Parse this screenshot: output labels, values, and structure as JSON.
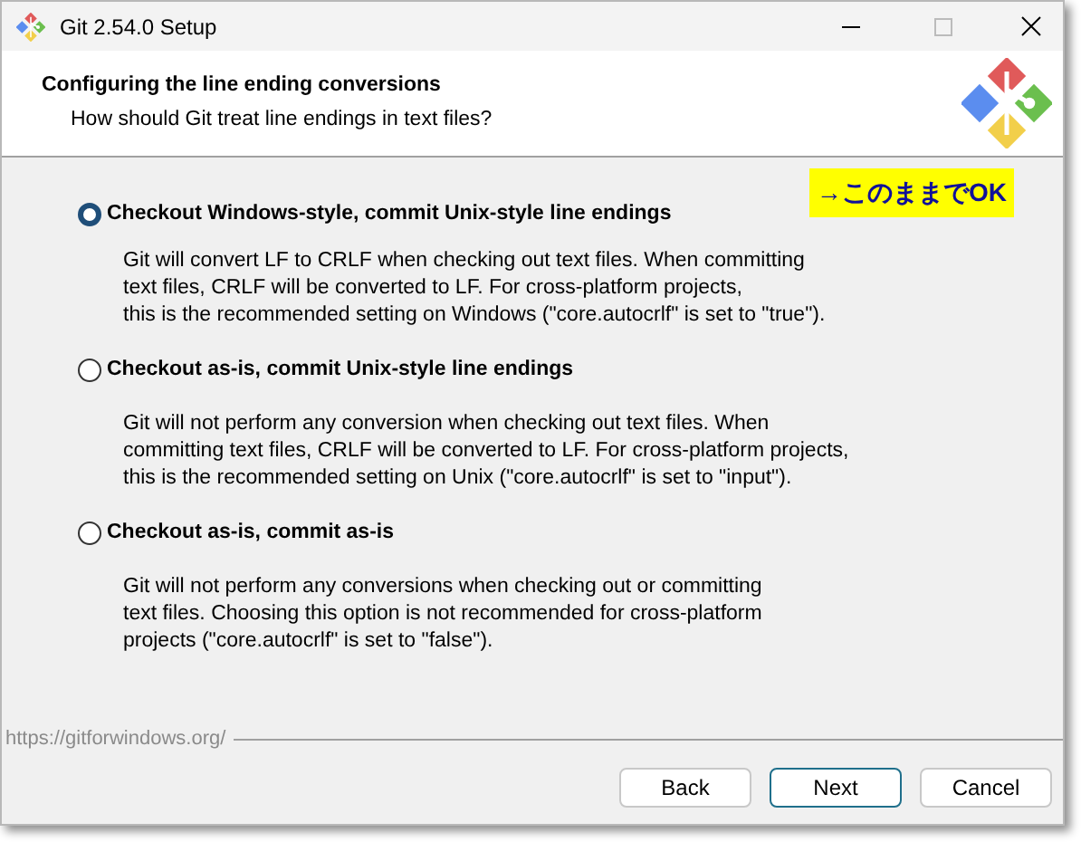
{
  "window": {
    "title": "Git 2.54.0 Setup"
  },
  "header": {
    "title": "Configuring the line ending conversions",
    "subtitle": "How should Git treat line endings in text files?"
  },
  "annotation": "→このままでOK",
  "options": [
    {
      "label": "Checkout Windows-style, commit Unix-style line endings",
      "selected": true,
      "description": [
        "Git will convert LF to CRLF when checking out text files. When committing",
        "text files, CRLF will be converted to LF. For cross-platform projects,",
        "this is the recommended setting on Windows (\"core.autocrlf\" is set to \"true\")."
      ]
    },
    {
      "label": "Checkout as-is, commit Unix-style line endings",
      "selected": false,
      "description": [
        "Git will not perform any conversion when checking out text files. When",
        "committing text files, CRLF will be converted to LF. For cross-platform projects,",
        "this is the recommended setting on Unix (\"core.autocrlf\" is set to \"input\")."
      ]
    },
    {
      "label": "Checkout as-is, commit as-is",
      "selected": false,
      "description": [
        "Git will not perform any conversions when checking out or committing",
        "text files. Choosing this option is not recommended for cross-platform",
        "projects (\"core.autocrlf\" is set to \"false\")."
      ]
    }
  ],
  "footer": {
    "url": "https://gitforwindows.org/"
  },
  "buttons": [
    {
      "label": "Back",
      "default": false
    },
    {
      "label": "Next",
      "default": true
    },
    {
      "label": "Cancel",
      "default": false
    }
  ]
}
